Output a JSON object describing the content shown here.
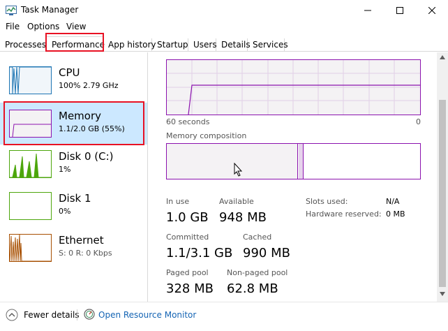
{
  "window": {
    "title": "Task Manager"
  },
  "menu": [
    "File",
    "Options",
    "View"
  ],
  "tabs": [
    "Processes",
    "Performance",
    "App history",
    "Startup",
    "Users",
    "Details",
    "Services"
  ],
  "sidebar": {
    "items": [
      {
        "title": "CPU",
        "sub": "100%  2.79 GHz",
        "color": "#1c74b3"
      },
      {
        "title": "Memory",
        "sub": "1.1/2.0 GB (55%)",
        "color": "#8b12ae"
      },
      {
        "title": "Disk 0 (C:)",
        "sub": "1%",
        "color": "#4da60c"
      },
      {
        "title": "Disk 1",
        "sub": "0%",
        "color": "#4da60c"
      },
      {
        "title": "Ethernet",
        "sub": "S: 0 R: 0 Kbps",
        "color": "#a74f01"
      }
    ]
  },
  "main": {
    "axis_left": "60 seconds",
    "axis_right": "0",
    "composition_label": "Memory composition",
    "stats": {
      "in_use_label": "In use",
      "in_use_value": "1.0 GB",
      "available_label": "Available",
      "available_value": "948 MB",
      "committed_label": "Committed",
      "committed_value": "1.1/3.1 GB",
      "cached_label": "Cached",
      "cached_value": "990 MB",
      "paged_label": "Paged pool",
      "paged_value": "328 MB",
      "nonpaged_label": "Non-paged pool",
      "nonpaged_value": "62.8 MB"
    },
    "details": {
      "slots_label": "Slots used:",
      "slots_value": "N/A",
      "hw_label": "Hardware reserved:",
      "hw_value": "0 MB"
    }
  },
  "footer": {
    "fewer_details": "Fewer details",
    "resource_monitor": "Open Resource Monitor"
  },
  "colors": {
    "memory": "#8b12ae",
    "highlight": "#e81123",
    "selected_bg": "#cce8ff",
    "link": "#1464b4"
  }
}
